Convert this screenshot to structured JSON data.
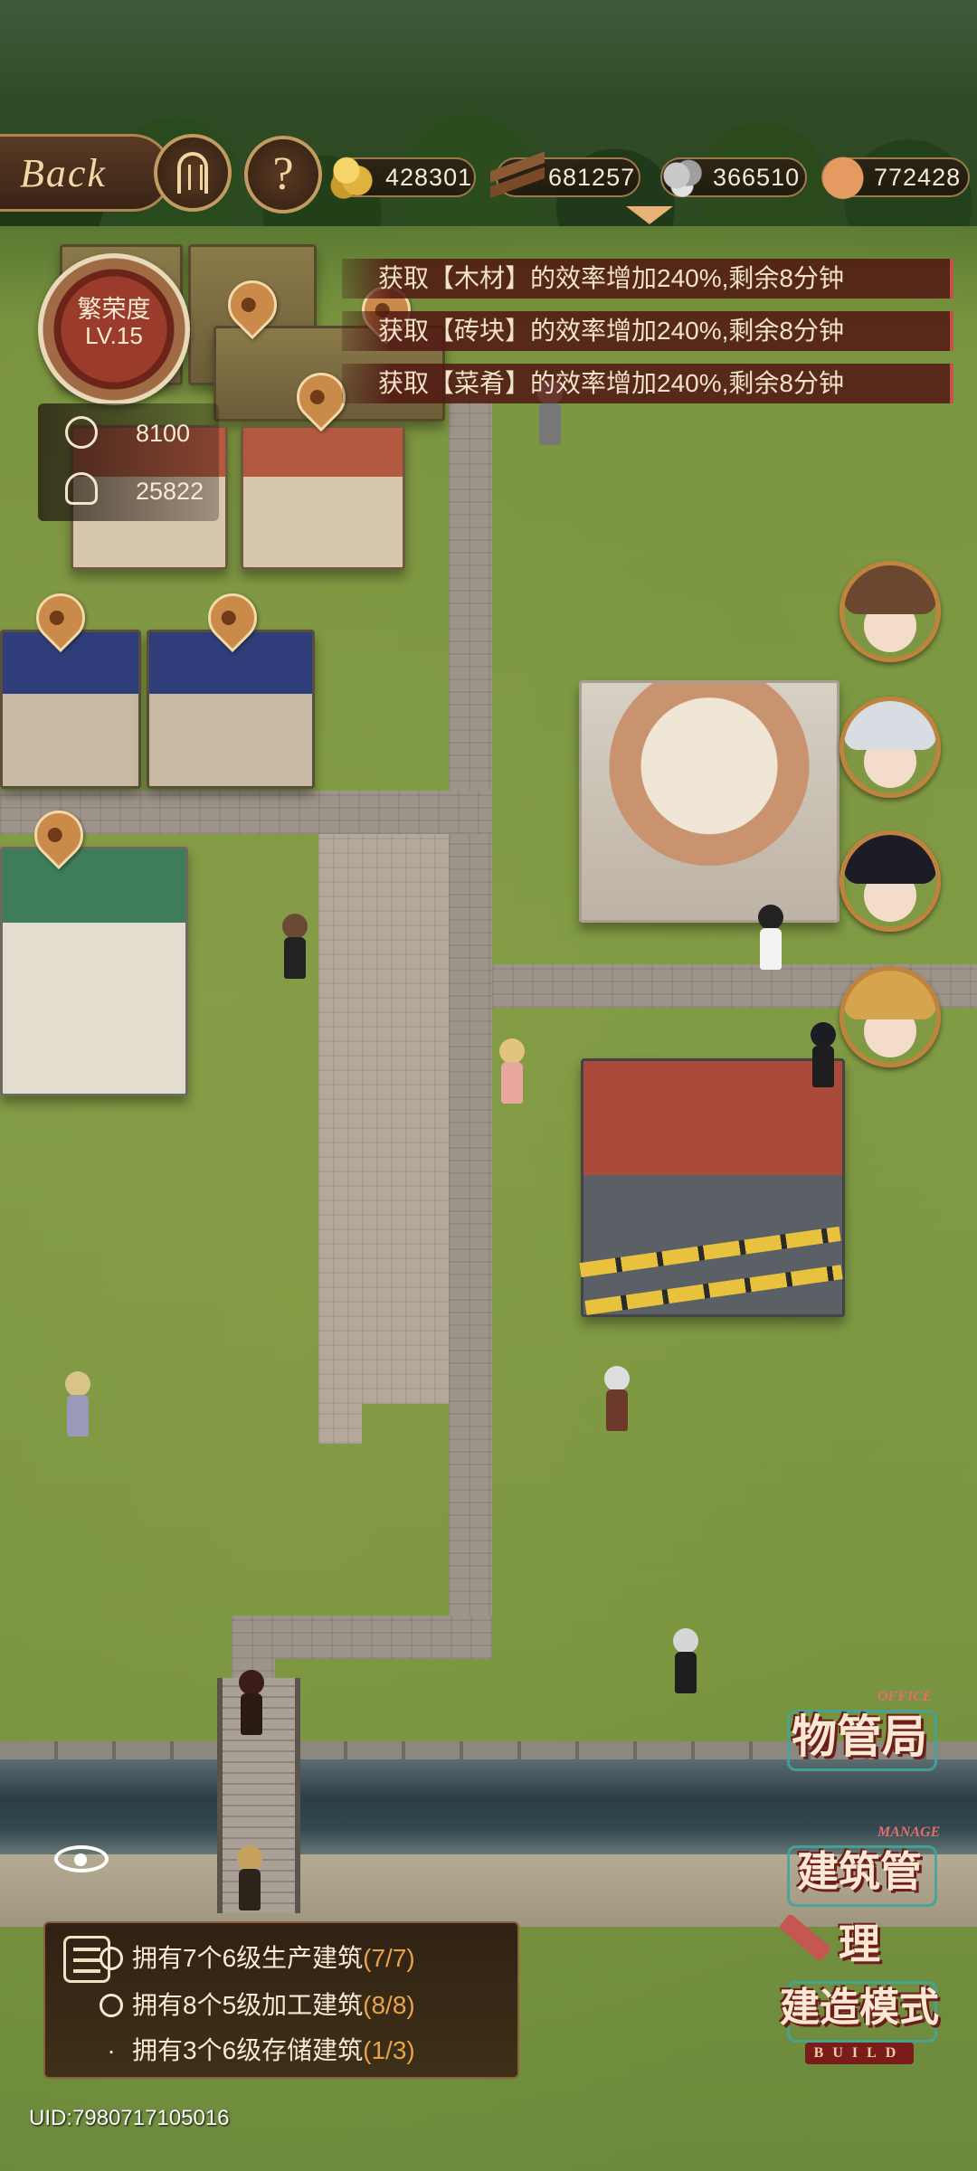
{
  "hud": {
    "back_label": "Back",
    "help_label": "?",
    "resources": {
      "coin": "428301",
      "wood": "681257",
      "brick": "366510",
      "food": "772428"
    }
  },
  "prosperity": {
    "title": "繁荣度",
    "level": "LV.15",
    "medal_score": "8100",
    "population": "25822"
  },
  "buffs": [
    "获取【木材】的效率增加240%,剩余8分钟",
    "获取【砖块】的效率增加240%,剩余8分钟",
    "获取【菜肴】的效率增加240%,剩余8分钟"
  ],
  "side_menu": {
    "office": {
      "label": "物管局",
      "sub": "OFFICE"
    },
    "manage": {
      "label": "建筑管理",
      "sub": "MANAGE"
    },
    "build": {
      "label": "建造模式",
      "badge": "BUILD"
    }
  },
  "quests": [
    {
      "text": "拥有7个6级生产建筑",
      "progress": "(7/7)",
      "done": true
    },
    {
      "text": "拥有8个5级加工建筑",
      "progress": "(8/8)",
      "done": true
    },
    {
      "text": "拥有3个6级存储建筑",
      "progress": "(1/3)",
      "done": false
    }
  ],
  "uid": "UID:7980717105016",
  "colors": {
    "accent_gold": "#c29a62",
    "buff_bg": "#50161 2",
    "progress_orange": "#e9a24a",
    "side_menu_red": "#6d1e1b",
    "side_menu_teal": "#41a59a"
  },
  "icons": [
    "gate-icon",
    "help-icon",
    "coin-icon",
    "wood-icon",
    "brick-icon",
    "food-icon",
    "medal-icon",
    "people-icon",
    "eye-icon",
    "checklist-icon",
    "check-circle-icon",
    "hammer-icon"
  ]
}
